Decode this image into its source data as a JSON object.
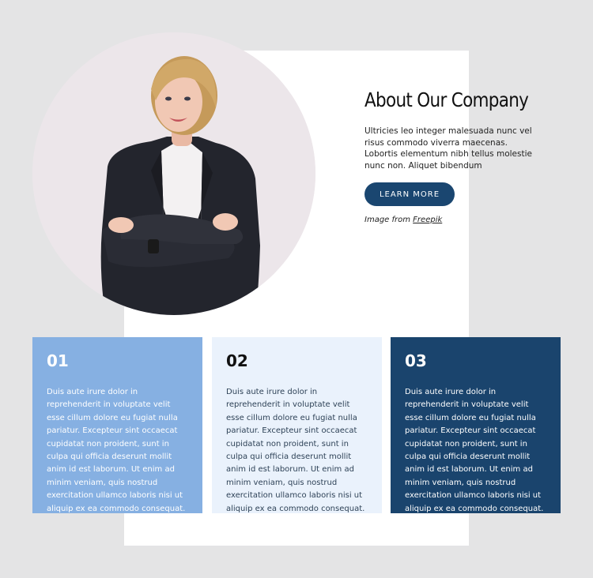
{
  "about": {
    "title": "About Our Company",
    "intro": "Ultricies leo integer malesuada nunc vel risus commodo viverra maecenas. Lobortis elementum nibh tellus molestie nunc non. Aliquet bibendum",
    "button_label": "LEARN MORE",
    "credit_prefix": "Image from ",
    "credit_link": "Freepik"
  },
  "cards": [
    {
      "number": "01",
      "text": "Duis aute irure dolor in reprehenderit in voluptate velit esse cillum dolore eu fugiat nulla pariatur. Excepteur sint occaecat cupidatat non proident, sunt in culpa qui officia deserunt mollit anim id est laborum. Ut enim ad minim veniam, quis nostrud exercitation ullamco laboris nisi ut aliquip ex ea commodo consequat."
    },
    {
      "number": "02",
      "text": "Duis aute irure dolor in reprehenderit in voluptate velit esse cillum dolore eu fugiat nulla pariatur. Excepteur sint occaecat cupidatat non proident, sunt in culpa qui officia deserunt mollit anim id est laborum. Ut enim ad minim veniam, quis nostrud exercitation ullamco laboris nisi ut aliquip ex ea commodo consequat."
    },
    {
      "number": "03",
      "text": "Duis aute irure dolor in reprehenderit in voluptate velit esse cillum dolore eu fugiat nulla pariatur. Excepteur sint occaecat cupidatat non proident, sunt in culpa qui officia deserunt mollit anim id est laborum. Ut enim ad minim veniam, quis nostrud exercitation ullamco laboris nisi ut aliquip ex ea commodo consequat."
    }
  ],
  "colors": {
    "page_background": "#e4e4e5",
    "button": "#1a4670",
    "card_1": "#86b0e2",
    "card_2": "#eaf2fc",
    "card_3": "#1a446d"
  }
}
